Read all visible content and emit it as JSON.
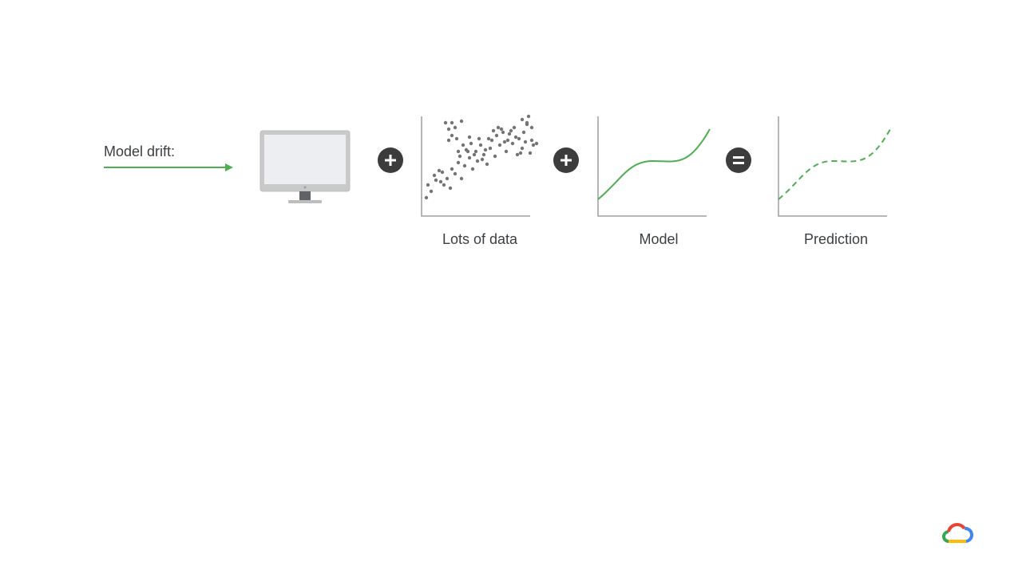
{
  "slide": {
    "title": "Model drift:",
    "operators": [
      "plus-icon",
      "plus-icon",
      "equals-icon"
    ],
    "captions": {
      "data": "Lots of data",
      "model": "Model",
      "prediction": "Prediction"
    },
    "colors": {
      "accent_green": "#4caf50",
      "text": "#3c4043",
      "operator_bg": "#3c3c3c",
      "axis": "#9e9e9e",
      "dot": "#757575"
    },
    "logo": "google-cloud-logo-icon"
  }
}
